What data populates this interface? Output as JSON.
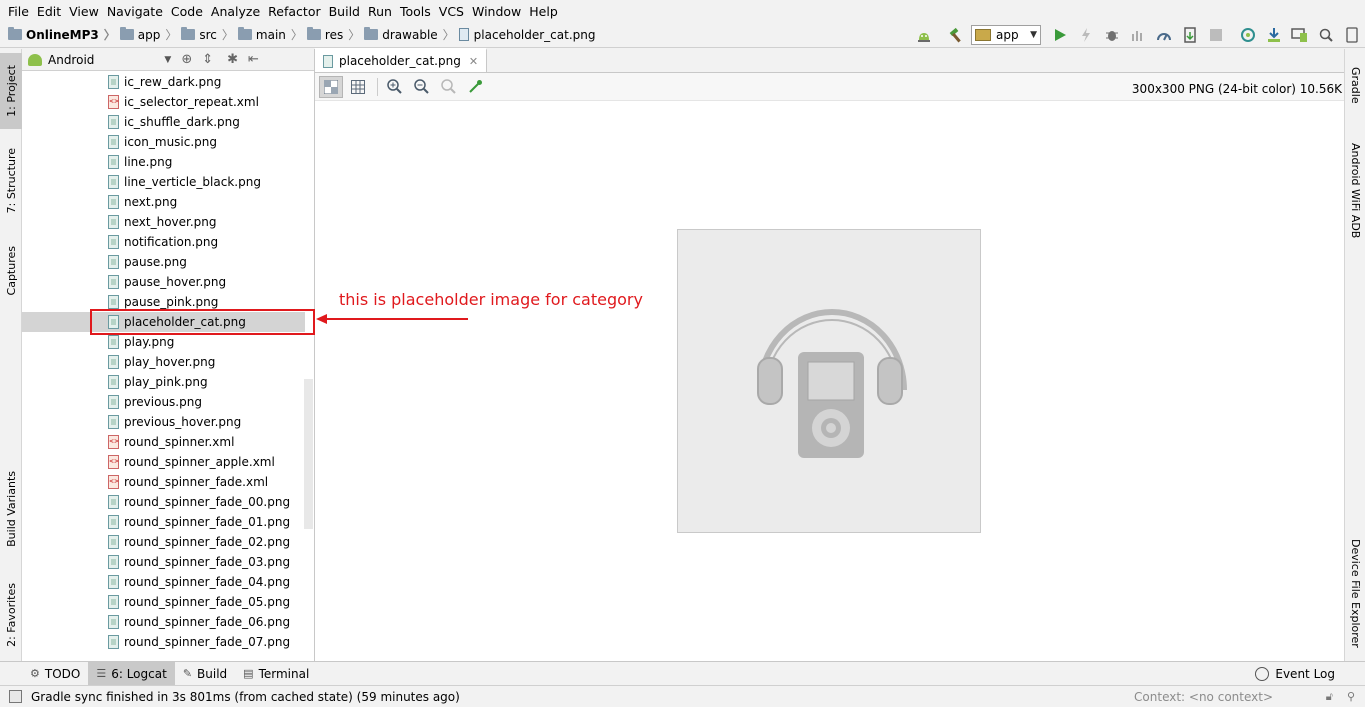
{
  "menu": [
    "File",
    "Edit",
    "View",
    "Navigate",
    "Code",
    "Analyze",
    "Refactor",
    "Build",
    "Run",
    "Tools",
    "VCS",
    "Window",
    "Help"
  ],
  "breadcrumbs": [
    {
      "label": "OnlineMP3",
      "icon": "project-folder-icon"
    },
    {
      "label": "app",
      "icon": "module-folder-icon"
    },
    {
      "label": "src",
      "icon": "folder-icon"
    },
    {
      "label": "main",
      "icon": "folder-icon"
    },
    {
      "label": "res",
      "icon": "folder-icon"
    },
    {
      "label": "drawable",
      "icon": "folder-icon"
    },
    {
      "label": "placeholder_cat.png",
      "icon": "png-file-icon"
    }
  ],
  "toolbar": {
    "run_config": "app",
    "buttons": [
      "android-monitor-icon",
      "hammer-build-icon",
      "run-icon",
      "instant-run-icon",
      "debug-icon",
      "attach-debugger-icon",
      "profiler-icon",
      "apply-changes-icon",
      "stop-icon",
      "sync-gradle-icon",
      "sdk-manager-icon",
      "avd-manager-icon",
      "search-everywhere-icon",
      "device-icon"
    ]
  },
  "left_tabs": {
    "project": "1: Project",
    "structure": "7: Structure",
    "captures": "Captures",
    "build_variants": "Build Variants",
    "favorites": "2: Favorites"
  },
  "right_tabs": {
    "gradle": "Gradle",
    "wifi_adb": "Android WiFi ADB",
    "device_explorer": "Device File Explorer"
  },
  "project_panel": {
    "view_mode": "Android",
    "files": [
      {
        "name": "ic_rew_dark.png",
        "type": "png"
      },
      {
        "name": "ic_selector_repeat.xml",
        "type": "xml"
      },
      {
        "name": "ic_shuffle_dark.png",
        "type": "png"
      },
      {
        "name": "icon_music.png",
        "type": "png"
      },
      {
        "name": "line.png",
        "type": "png"
      },
      {
        "name": "line_verticle_black.png",
        "type": "png"
      },
      {
        "name": "next.png",
        "type": "png"
      },
      {
        "name": "next_hover.png",
        "type": "png"
      },
      {
        "name": "notification.png",
        "type": "png"
      },
      {
        "name": "pause.png",
        "type": "png"
      },
      {
        "name": "pause_hover.png",
        "type": "png"
      },
      {
        "name": "pause_pink.png",
        "type": "png"
      },
      {
        "name": "placeholder_cat.png",
        "type": "png",
        "selected": true
      },
      {
        "name": "play.png",
        "type": "png"
      },
      {
        "name": "play_hover.png",
        "type": "png"
      },
      {
        "name": "play_pink.png",
        "type": "png"
      },
      {
        "name": "previous.png",
        "type": "png"
      },
      {
        "name": "previous_hover.png",
        "type": "png"
      },
      {
        "name": "round_spinner.xml",
        "type": "xml"
      },
      {
        "name": "round_spinner_apple.xml",
        "type": "xml"
      },
      {
        "name": "round_spinner_fade.xml",
        "type": "xml"
      },
      {
        "name": "round_spinner_fade_00.png",
        "type": "png"
      },
      {
        "name": "round_spinner_fade_01.png",
        "type": "png"
      },
      {
        "name": "round_spinner_fade_02.png",
        "type": "png"
      },
      {
        "name": "round_spinner_fade_03.png",
        "type": "png"
      },
      {
        "name": "round_spinner_fade_04.png",
        "type": "png"
      },
      {
        "name": "round_spinner_fade_05.png",
        "type": "png"
      },
      {
        "name": "round_spinner_fade_06.png",
        "type": "png"
      },
      {
        "name": "round_spinner_fade_07.png",
        "type": "png"
      }
    ]
  },
  "editor": {
    "tab_label": "placeholder_cat.png",
    "image_info": "300x300 PNG (24-bit color) 10.56K"
  },
  "annotation": {
    "text": "this is placeholder image for category",
    "color": "#e0191d"
  },
  "bottom_tools": {
    "todo": "TODO",
    "logcat": "6: Logcat",
    "build": "Build",
    "terminal": "Terminal",
    "event_log": "Event Log"
  },
  "status": {
    "message": "Gradle sync finished in 3s 801ms (from cached state) (59 minutes ago)",
    "context": "Context: <no context>"
  }
}
